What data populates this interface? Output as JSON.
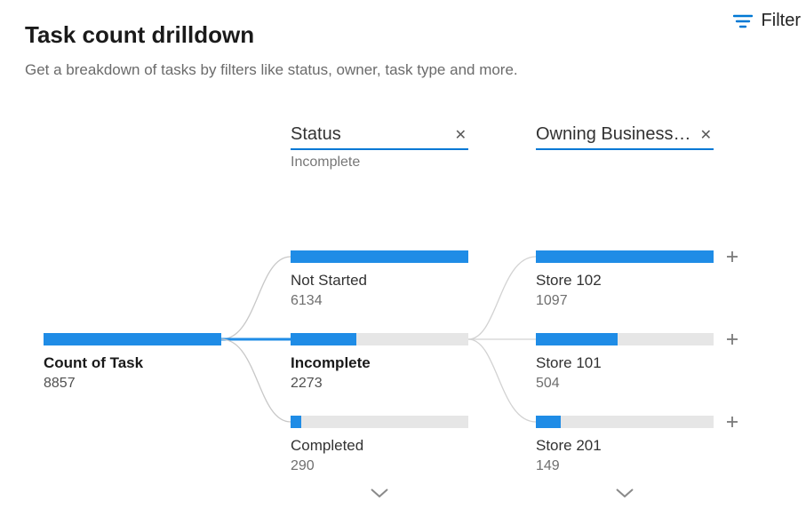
{
  "header": {
    "title": "Task count drilldown",
    "subtitle": "Get a breakdown of tasks by filters like status, owner, task type and more.",
    "filter_label": "Filter"
  },
  "columns": {
    "status": {
      "label": "Status",
      "sublabel": "Incomplete"
    },
    "owning": {
      "label": "Owning Business…"
    }
  },
  "root": {
    "name": "Count of Task",
    "value": "8857"
  },
  "status_nodes": [
    {
      "name": "Not Started",
      "value": "6134",
      "fill_pct": 100,
      "bold": false
    },
    {
      "name": "Incomplete",
      "value": "2273",
      "fill_pct": 37,
      "bold": true
    },
    {
      "name": "Completed",
      "value": "290",
      "fill_pct": 6,
      "bold": false
    }
  ],
  "owning_nodes": [
    {
      "name": "Store 102",
      "value": "1097",
      "fill_pct": 100
    },
    {
      "name": "Store 101",
      "value": "504",
      "fill_pct": 46
    },
    {
      "name": "Store 201",
      "value": "149",
      "fill_pct": 14
    }
  ],
  "colors": {
    "accent": "#1f8ce6",
    "underline": "#0078d4"
  },
  "chart_data": {
    "type": "bar",
    "title": "Task count drilldown",
    "root": {
      "label": "Count of Task",
      "value": 8857
    },
    "levels": [
      {
        "dimension": "Status",
        "selected": "Incomplete",
        "items": [
          {
            "label": "Not Started",
            "value": 6134
          },
          {
            "label": "Incomplete",
            "value": 2273
          },
          {
            "label": "Completed",
            "value": 290
          }
        ]
      },
      {
        "dimension": "Owning Business…",
        "items": [
          {
            "label": "Store 102",
            "value": 1097
          },
          {
            "label": "Store 101",
            "value": 504
          },
          {
            "label": "Store 201",
            "value": 149
          }
        ]
      }
    ]
  }
}
